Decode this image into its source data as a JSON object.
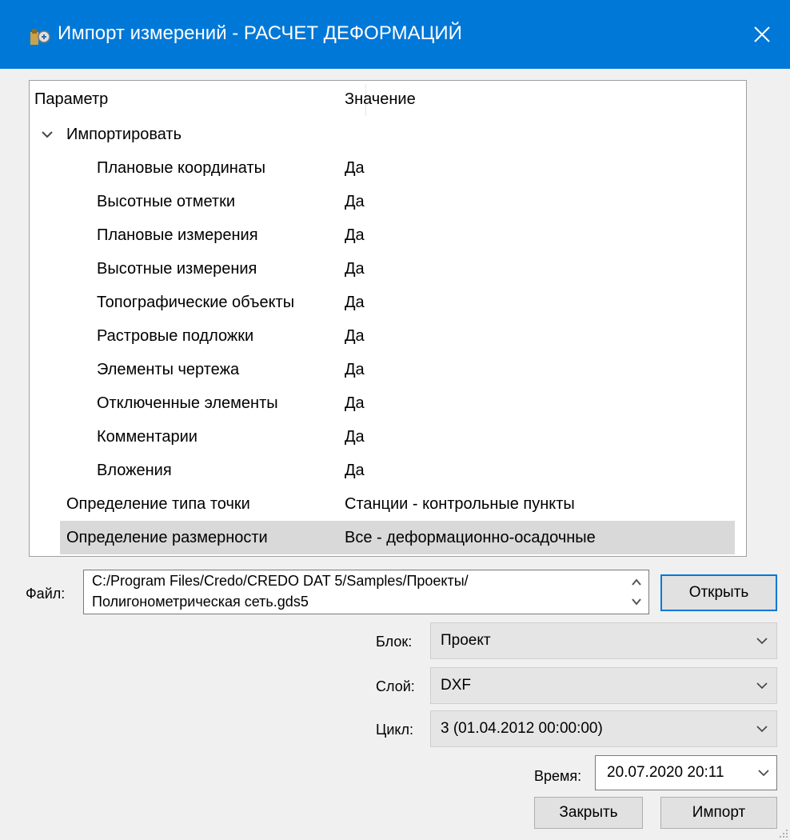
{
  "window": {
    "title": "Импорт измерений - РАСЧЕТ ДЕФОРМАЦИЙ",
    "accent_color": "#0078d7",
    "icon": "app-icon",
    "close_icon": "close-icon"
  },
  "tree": {
    "columns": [
      "Параметр",
      "Значение"
    ],
    "group": {
      "label": "Импортировать",
      "expanded": true,
      "icon": "chevron-down-icon"
    },
    "children": [
      {
        "param": "Плановые координаты",
        "value": "Да"
      },
      {
        "param": "Высотные отметки",
        "value": "Да"
      },
      {
        "param": "Плановые измерения",
        "value": "Да"
      },
      {
        "param": "Высотные измерения",
        "value": "Да"
      },
      {
        "param": "Топографические объекты",
        "value": "Да"
      },
      {
        "param": "Растровые подложки",
        "value": "Да"
      },
      {
        "param": "Элементы чертежа",
        "value": "Да"
      },
      {
        "param": "Отключенные элементы",
        "value": "Да"
      },
      {
        "param": "Комментарии",
        "value": "Да"
      },
      {
        "param": "Вложения",
        "value": "Да"
      }
    ],
    "rows": [
      {
        "param": "Определение типа точки",
        "value": "Станции - контрольные пункты"
      },
      {
        "param": "Определение размерности",
        "value": "Все - деформационно-осадочные",
        "selected": true
      }
    ]
  },
  "file": {
    "label": "Файл:",
    "value": "C:/Program Files/Credo/CREDO DAT 5/Samples/Проекты/\nПолигонометрическая сеть.gds5",
    "open_button": "Открыть"
  },
  "block": {
    "label": "Блок:",
    "value": "Проект"
  },
  "layer": {
    "label": "Слой:",
    "value": "DXF"
  },
  "cycle": {
    "label": "Цикл:",
    "value": "3 (01.04.2012 00:00:00)"
  },
  "time": {
    "label": "Время:",
    "value": "20.07.2020 20:11"
  },
  "buttons": {
    "close": "Закрыть",
    "import": "Импорт"
  }
}
